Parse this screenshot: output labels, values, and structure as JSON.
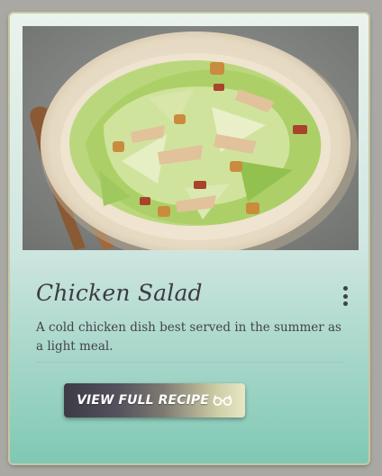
{
  "card": {
    "title": "Chicken Salad",
    "description": "A cold chicken dish best served in the summer as a light meal.",
    "cta_label": "VIEW FULL RECIPE",
    "cta_icon": "glasses-icon",
    "menu_icon": "more-vertical-icon",
    "image_subject": "chicken-salad-photo"
  },
  "colors": {
    "title": "#3d3b43",
    "description": "#44424a",
    "card_gradient_top": "#eaf3ec",
    "card_gradient_bottom": "#7fc8b4",
    "button_dark": "#3d3b45",
    "button_light": "#e7e7c6"
  }
}
